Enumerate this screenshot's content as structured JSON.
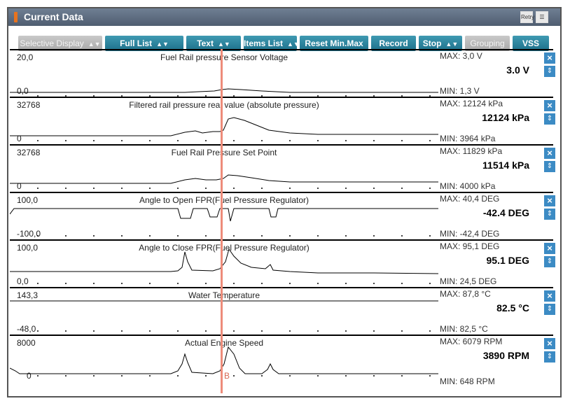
{
  "window": {
    "title": "Current Data",
    "retry_label": "Retry"
  },
  "toolbar": {
    "buttons": [
      {
        "label": "Selective Display",
        "dropdown": true,
        "disabled": true
      },
      {
        "label": "Full List",
        "dropdown": true,
        "disabled": false
      },
      {
        "label": "Text",
        "dropdown": true,
        "disabled": false
      },
      {
        "label": "Items List",
        "dropdown": true,
        "disabled": false
      },
      {
        "label": "Reset Min.Max",
        "dropdown": false,
        "disabled": false
      },
      {
        "label": "Record",
        "dropdown": false,
        "disabled": false
      },
      {
        "label": "Stop",
        "dropdown": true,
        "disabled": false
      },
      {
        "label": "Grouping",
        "dropdown": false,
        "disabled": true
      },
      {
        "label": "VSS",
        "dropdown": false,
        "disabled": false
      }
    ]
  },
  "channels": [
    {
      "title": "Fuel Rail pressure Sensor Voltage",
      "axis_max": "20,0",
      "axis_min": "0,0",
      "max": "MAX:   3,0 V",
      "current": "3.0 V",
      "min": "MIN:   1,3 V"
    },
    {
      "title": "Filtered rail pressure real value (absolute pressure)",
      "axis_max": "32768",
      "axis_min": "0",
      "max": "MAX: 12124 kPa",
      "current": "12124 kPa",
      "min": "MIN:  3964 kPa"
    },
    {
      "title": "Fuel Rail Pressure Set Point",
      "axis_max": "32768",
      "axis_min": "0",
      "max": "MAX: 11829 kPa",
      "current": "11514 kPa",
      "min": "MIN:  4000 kPa"
    },
    {
      "title": "Angle to Open FPR(Fuel Pressure Regulator)",
      "axis_max": "100,0",
      "axis_min": "-100,0",
      "max": "MAX:  40,4 DEG",
      "current": "-42.4 DEG",
      "min": "MIN: -42,4 DEG"
    },
    {
      "title": "Angle to Close FPR(Fuel Pressure Regulator)",
      "axis_max": "100,0",
      "axis_min": "0,0",
      "max": "MAX:  95,1 DEG",
      "current": "95.1 DEG",
      "min": "MIN:  24,5 DEG"
    },
    {
      "title": "Water Temperature",
      "axis_max": "143,3",
      "axis_min": "-48,0",
      "max": "MAX:  87,8 °C",
      "current": "82.5 °C",
      "min": "MIN:  82,5 °C"
    },
    {
      "title": "Actual Engine Speed",
      "axis_max": "8000",
      "axis_min": "0",
      "max": "MAX:  6079 RPM",
      "current": "3890 RPM",
      "min": "MIN:   648 RPM"
    }
  ],
  "cursor": {
    "label": "B"
  },
  "colors": {
    "accent": "#1d6f8a",
    "cursor": "#ee8c7a",
    "close_button": "#3c8bc4"
  }
}
